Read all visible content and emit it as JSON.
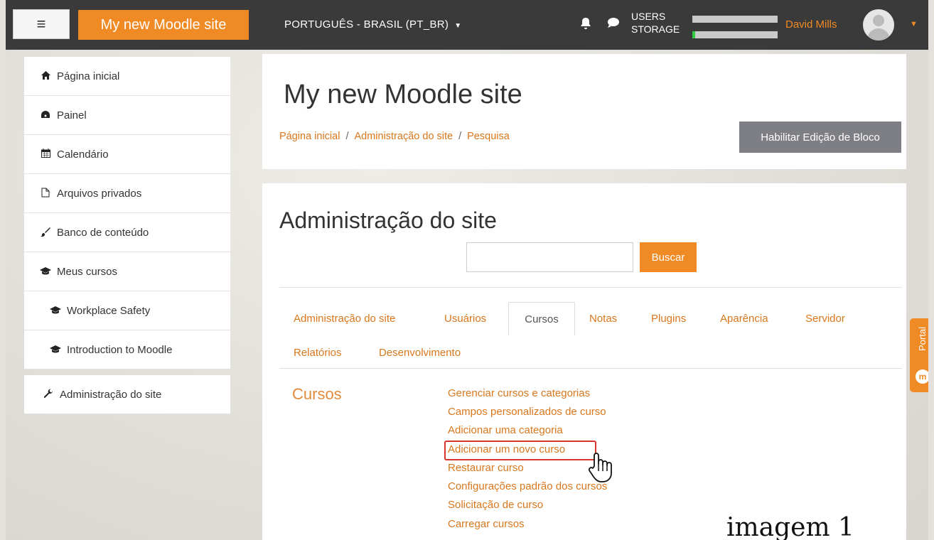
{
  "navbar": {
    "menu_icon": "≡",
    "site_name": "My new Moodle site",
    "language": "PORTUGUÊS - BRASIL (PT_BR)",
    "quota_users": "USERS",
    "quota_storage": "STORAGE",
    "user_name": "David Mills"
  },
  "sidebar": {
    "items": [
      {
        "label": "Página inicial",
        "icon": "home-icon"
      },
      {
        "label": "Painel",
        "icon": "dashboard-icon"
      },
      {
        "label": "Calendário",
        "icon": "calendar-icon"
      },
      {
        "label": "Arquivos privados",
        "icon": "file-icon"
      },
      {
        "label": "Banco de conteúdo",
        "icon": "brush-icon"
      },
      {
        "label": "Meus cursos",
        "icon": "graduation-cap-icon"
      },
      {
        "label": "Workplace Safety",
        "icon": "graduation-cap-icon"
      },
      {
        "label": "Introduction to Moodle",
        "icon": "graduation-cap-icon"
      }
    ],
    "admin_item": {
      "label": "Administração do site",
      "icon": "wrench-icon"
    }
  },
  "header": {
    "title": "My new Moodle site",
    "breadcrumb": [
      "Página inicial",
      "Administração do site",
      "Pesquisa"
    ],
    "edit_button": "Habilitar Edição de Bloco"
  },
  "main": {
    "title": "Administração do site",
    "search_button": "Buscar",
    "tabs": [
      "Administração do site",
      "Usuários",
      "Cursos",
      "Notas",
      "Plugins",
      "Aparência",
      "Servidor",
      "Relatórios",
      "Desenvolvimento"
    ],
    "active_tab": "Cursos",
    "section_title": "Cursos",
    "links": [
      "Gerenciar cursos e categorias",
      "Campos personalizados de curso",
      "Adicionar uma categoria",
      "Adicionar um novo curso",
      "Restaurar curso",
      "Configurações padrão dos cursos",
      "Solicitação de curso",
      "Carregar cursos"
    ],
    "highlighted_link": "Adicionar um novo curso"
  },
  "portal_tab": {
    "label": "Portal",
    "icon": "portal-icon"
  },
  "caption": "imagem 1",
  "colors": {
    "accent": "#f08a24",
    "navbar": "#3a3a3a",
    "link": "#d9771d",
    "highlight_border": "#d9342b"
  }
}
